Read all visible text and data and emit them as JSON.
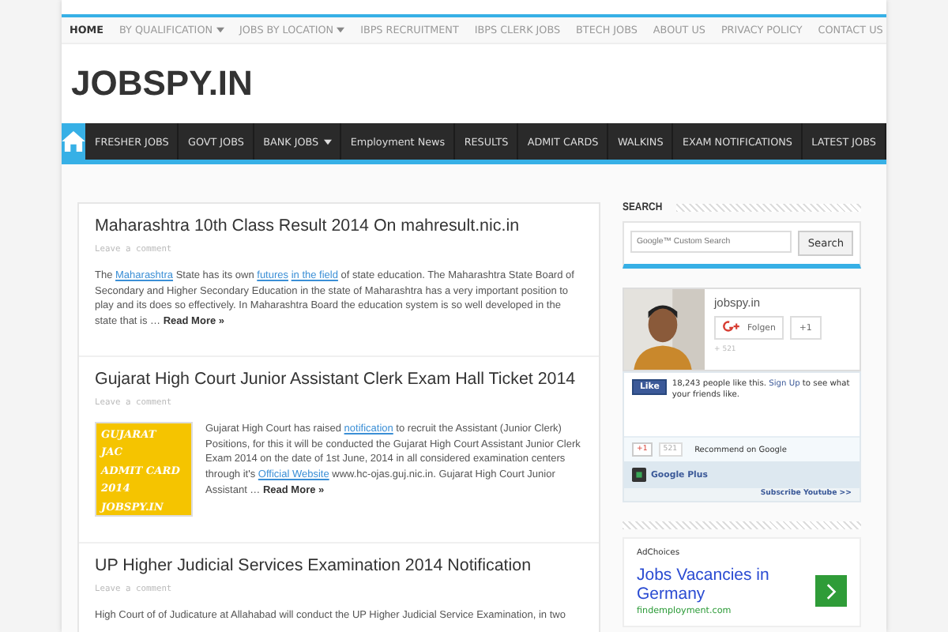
{
  "top_nav": [
    {
      "label": "HOME",
      "selected": true,
      "has_menu": false
    },
    {
      "label": "BY QUALIFICATION",
      "selected": false,
      "has_menu": true
    },
    {
      "label": "JOBS BY LOCATION",
      "selected": false,
      "has_menu": true
    },
    {
      "label": "IBPS RECRUITMENT",
      "selected": false,
      "has_menu": false
    },
    {
      "label": "IBPS CLERK JOBS",
      "selected": false,
      "has_menu": false
    },
    {
      "label": "BTECH JOBS",
      "selected": false,
      "has_menu": false
    },
    {
      "label": "ABOUT US",
      "selected": false,
      "has_menu": false
    },
    {
      "label": "PRIVACY POLICY",
      "selected": false,
      "has_menu": false
    },
    {
      "label": "CONTACT US",
      "selected": false,
      "has_menu": false
    }
  ],
  "logo": "JOBSPY.IN",
  "main_nav": {
    "home_selected": true,
    "items": [
      {
        "label": "FRESHER JOBS",
        "has_menu": false
      },
      {
        "label": "GOVT JOBS",
        "has_menu": false
      },
      {
        "label": "BANK JOBS",
        "has_menu": true
      },
      {
        "label": "Employment News",
        "has_menu": false
      },
      {
        "label": "RESULTS",
        "has_menu": false
      },
      {
        "label": "ADMIT CARDS",
        "has_menu": false
      },
      {
        "label": "WALKINS",
        "has_menu": false
      },
      {
        "label": "EXAM NOTIFICATIONS",
        "has_menu": false
      },
      {
        "label": "LATEST JOBS",
        "has_menu": false
      }
    ]
  },
  "posts": [
    {
      "title": "Maharashtra 10th Class Result 2014 On mahresult.nic.in",
      "meta": "Leave a comment",
      "excerpt": [
        {
          "kind": "text",
          "text": "The "
        },
        {
          "kind": "link",
          "text": "Maharashtra"
        },
        {
          "kind": "text",
          "text": " State has its own "
        },
        {
          "kind": "link",
          "text": "futures"
        },
        {
          "kind": "link",
          "text": "in the field"
        },
        {
          "kind": "text",
          "text": " of state education. The Maharashtra State Board of Secondary and Higher Secondary Education in the state of Maharashtra has a very important position to play and its does so effectively. In Maharashtra Board the education system is so well developed in the state that is … "
        },
        {
          "kind": "more",
          "text": "Read More »"
        }
      ]
    },
    {
      "title": "Gujarat High Court Junior Assistant Clerk Exam Hall Ticket 2014",
      "meta": "Leave a comment",
      "thumbnail": [
        "GUJARAT",
        "JAC",
        "ADMIT CARD",
        "2014",
        "JOBSPY.IN"
      ],
      "excerpt": [
        {
          "kind": "text",
          "text": "Gujarat High Court has raised "
        },
        {
          "kind": "link",
          "text": "notification"
        },
        {
          "kind": "text",
          "text": " to recruit the Assistant (Junior Clerk) Positions, for this it will be conducted the Gujarat High Court Assistant Junior Clerk Exam 2014 on the date of 1st June, 2014 in all considered examination centers through it's "
        },
        {
          "kind": "link",
          "text": "Official Website"
        },
        {
          "kind": "text",
          "text": " www.hc-ojas.guj.nic.in.  Gujarat High Court Junior Assistant … "
        },
        {
          "kind": "more",
          "text": "Read More »"
        }
      ]
    },
    {
      "title": "UP Higher Judicial Services Examination 2014 Notification",
      "meta": "Leave a comment",
      "excerpt": [
        {
          "kind": "text",
          "text": "High Court of of Judicature at Allahabad will conduct the UP Higher Judicial Service Examination, in two"
        }
      ]
    }
  ],
  "sidebar": {
    "search_heading": "SEARCH",
    "search_placeholder": "Google™ Custom Search",
    "search_button": "Search",
    "gplus": {
      "name": "jobspy.in",
      "follow": "Folgen",
      "plus_one": "+1",
      "count": "+ 521"
    },
    "facebook": {
      "like": "Like",
      "text_before": "18,243 people like this. ",
      "signup": "Sign Up",
      "text_after": " to see what your friends like."
    },
    "recommend": {
      "plus_one": "+1",
      "count": "521",
      "label": "Recommend on Google"
    },
    "google_plus": "Google Plus",
    "subscribe": "Subscribe Youtube >>",
    "ad": {
      "adchoices": "AdChoices",
      "title": "Jobs Vacancies in Germany",
      "url": "findemployment.com"
    }
  }
}
